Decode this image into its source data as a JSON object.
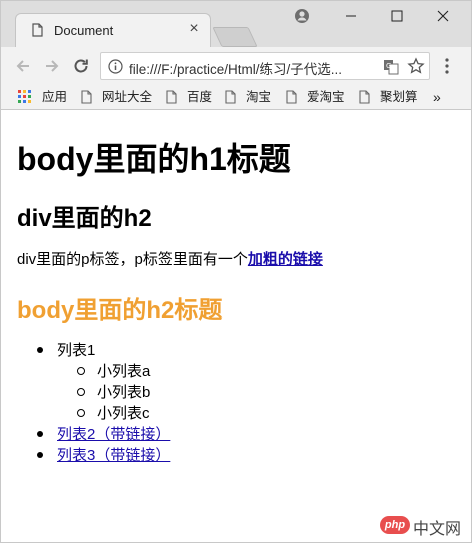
{
  "browser": {
    "tab": {
      "title": "Document",
      "close": "×"
    },
    "address": {
      "url": "file:///F:/practice/Html/练习/子代选..."
    },
    "bookmarks": [
      {
        "label": "应用",
        "icon": "apps-icon"
      },
      {
        "label": "网址大全",
        "icon": "page-icon"
      },
      {
        "label": "百度",
        "icon": "page-icon"
      },
      {
        "label": "淘宝",
        "icon": "page-icon"
      },
      {
        "label": "爱淘宝",
        "icon": "page-icon"
      },
      {
        "label": "聚划算",
        "icon": "page-icon"
      }
    ],
    "more_bookmarks": "»"
  },
  "page": {
    "h1": "body里面的h1标题",
    "h2_div": "div里面的h2",
    "paragraph_text": "div里面的p标签，p标签里面有一个",
    "paragraph_link": "加粗的链接",
    "h2_body": "body里面的h2标题",
    "list": {
      "item1": "列表1",
      "subitems": [
        "小列表a",
        "小列表b",
        "小列表c"
      ],
      "item2": "列表2（带链接）",
      "item3": "列表3（带链接）"
    }
  },
  "watermark": {
    "badge": "php",
    "text": "中文网"
  },
  "colors": {
    "h2_body": "#f0a032",
    "link": "#1a0dab"
  }
}
